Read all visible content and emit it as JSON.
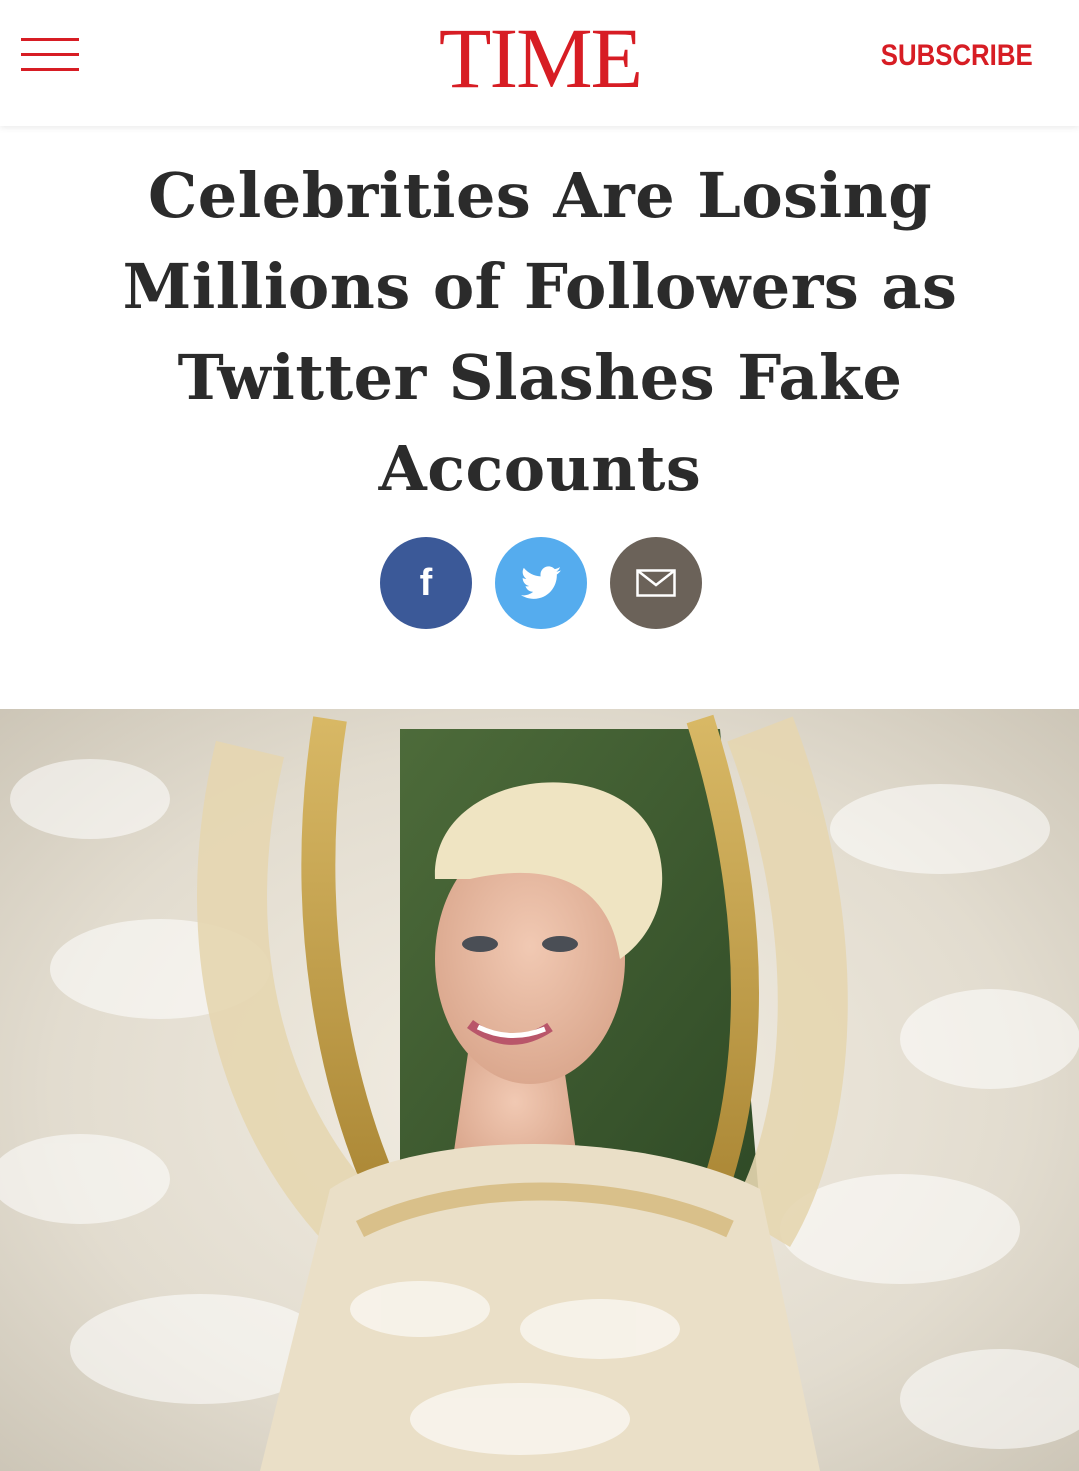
{
  "header": {
    "logo_text": "TIME",
    "subscribe_label": "SUBSCRIBE",
    "menu_icon": "hamburger-menu-icon"
  },
  "article": {
    "headline": "Celebrities Are Losing Millions of Followers as Twitter Slashes Fake Accounts"
  },
  "share": {
    "facebook": {
      "icon": "facebook-icon",
      "glyph": "f"
    },
    "twitter": {
      "icon": "twitter-bird-icon"
    },
    "email": {
      "icon": "envelope-icon"
    }
  },
  "colors": {
    "brand_red": "#d71d24",
    "facebook_blue": "#3b5998",
    "twitter_blue": "#55acee",
    "email_gray": "#6b6259",
    "headline_text": "#2b2b2b"
  }
}
